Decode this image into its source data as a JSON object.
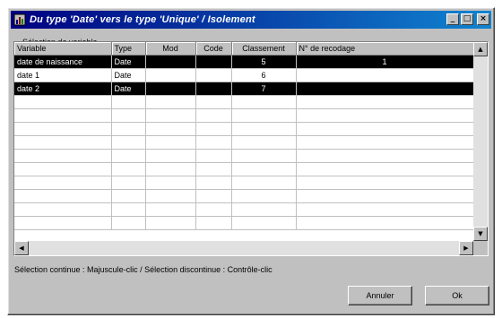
{
  "window": {
    "title": "Du type 'Date' vers le type 'Unique' / Isolement"
  },
  "caption": "Sélection de variable",
  "columns": [
    "Variable",
    "Type",
    "Mod",
    "Code",
    "Classement",
    "N° de recodage"
  ],
  "rows": [
    {
      "variable": "date de naissance",
      "type": "Date",
      "mod": "",
      "code": "",
      "classement": "5",
      "recodage": "1",
      "selected": true
    },
    {
      "variable": "date 1",
      "type": "Date",
      "mod": "",
      "code": "",
      "classement": "6",
      "recodage": "",
      "selected": false
    },
    {
      "variable": "date 2",
      "type": "Date",
      "mod": "",
      "code": "",
      "classement": "7",
      "recodage": "",
      "selected": true
    }
  ],
  "hint": "Sélection continue : Majuscule-clic / Sélection discontinue : Contrôle-clic",
  "buttons": {
    "cancel": "Annuler",
    "ok": "Ok"
  },
  "titlebar_buttons": {
    "minimize": "_",
    "maximize": "□",
    "close": "×"
  },
  "scroll_glyphs": {
    "up": "▲",
    "down": "▼",
    "left": "◀",
    "right": "▶"
  },
  "icons": [
    "app-icon",
    "minimize-icon",
    "maximize-icon",
    "close-icon"
  ]
}
